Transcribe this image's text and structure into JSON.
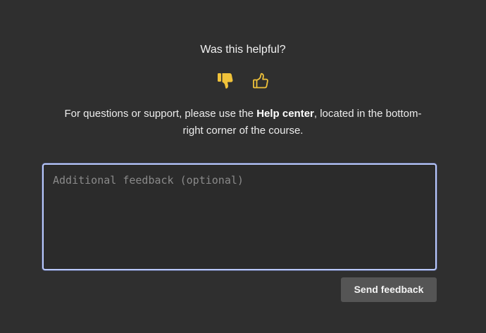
{
  "feedback": {
    "question": "Was this helpful?",
    "thumbs_down_icon": "thumbs-down-filled-icon",
    "thumbs_up_icon": "thumbs-up-outline-icon",
    "accent_color": "#f0c23a",
    "info_prefix": "For questions or support, please use the ",
    "info_link": "Help center",
    "info_suffix": ", located in the bottom-right corner of the course.",
    "textarea_placeholder": "Additional feedback (optional)",
    "textarea_value": "",
    "send_label": "Send feedback"
  }
}
